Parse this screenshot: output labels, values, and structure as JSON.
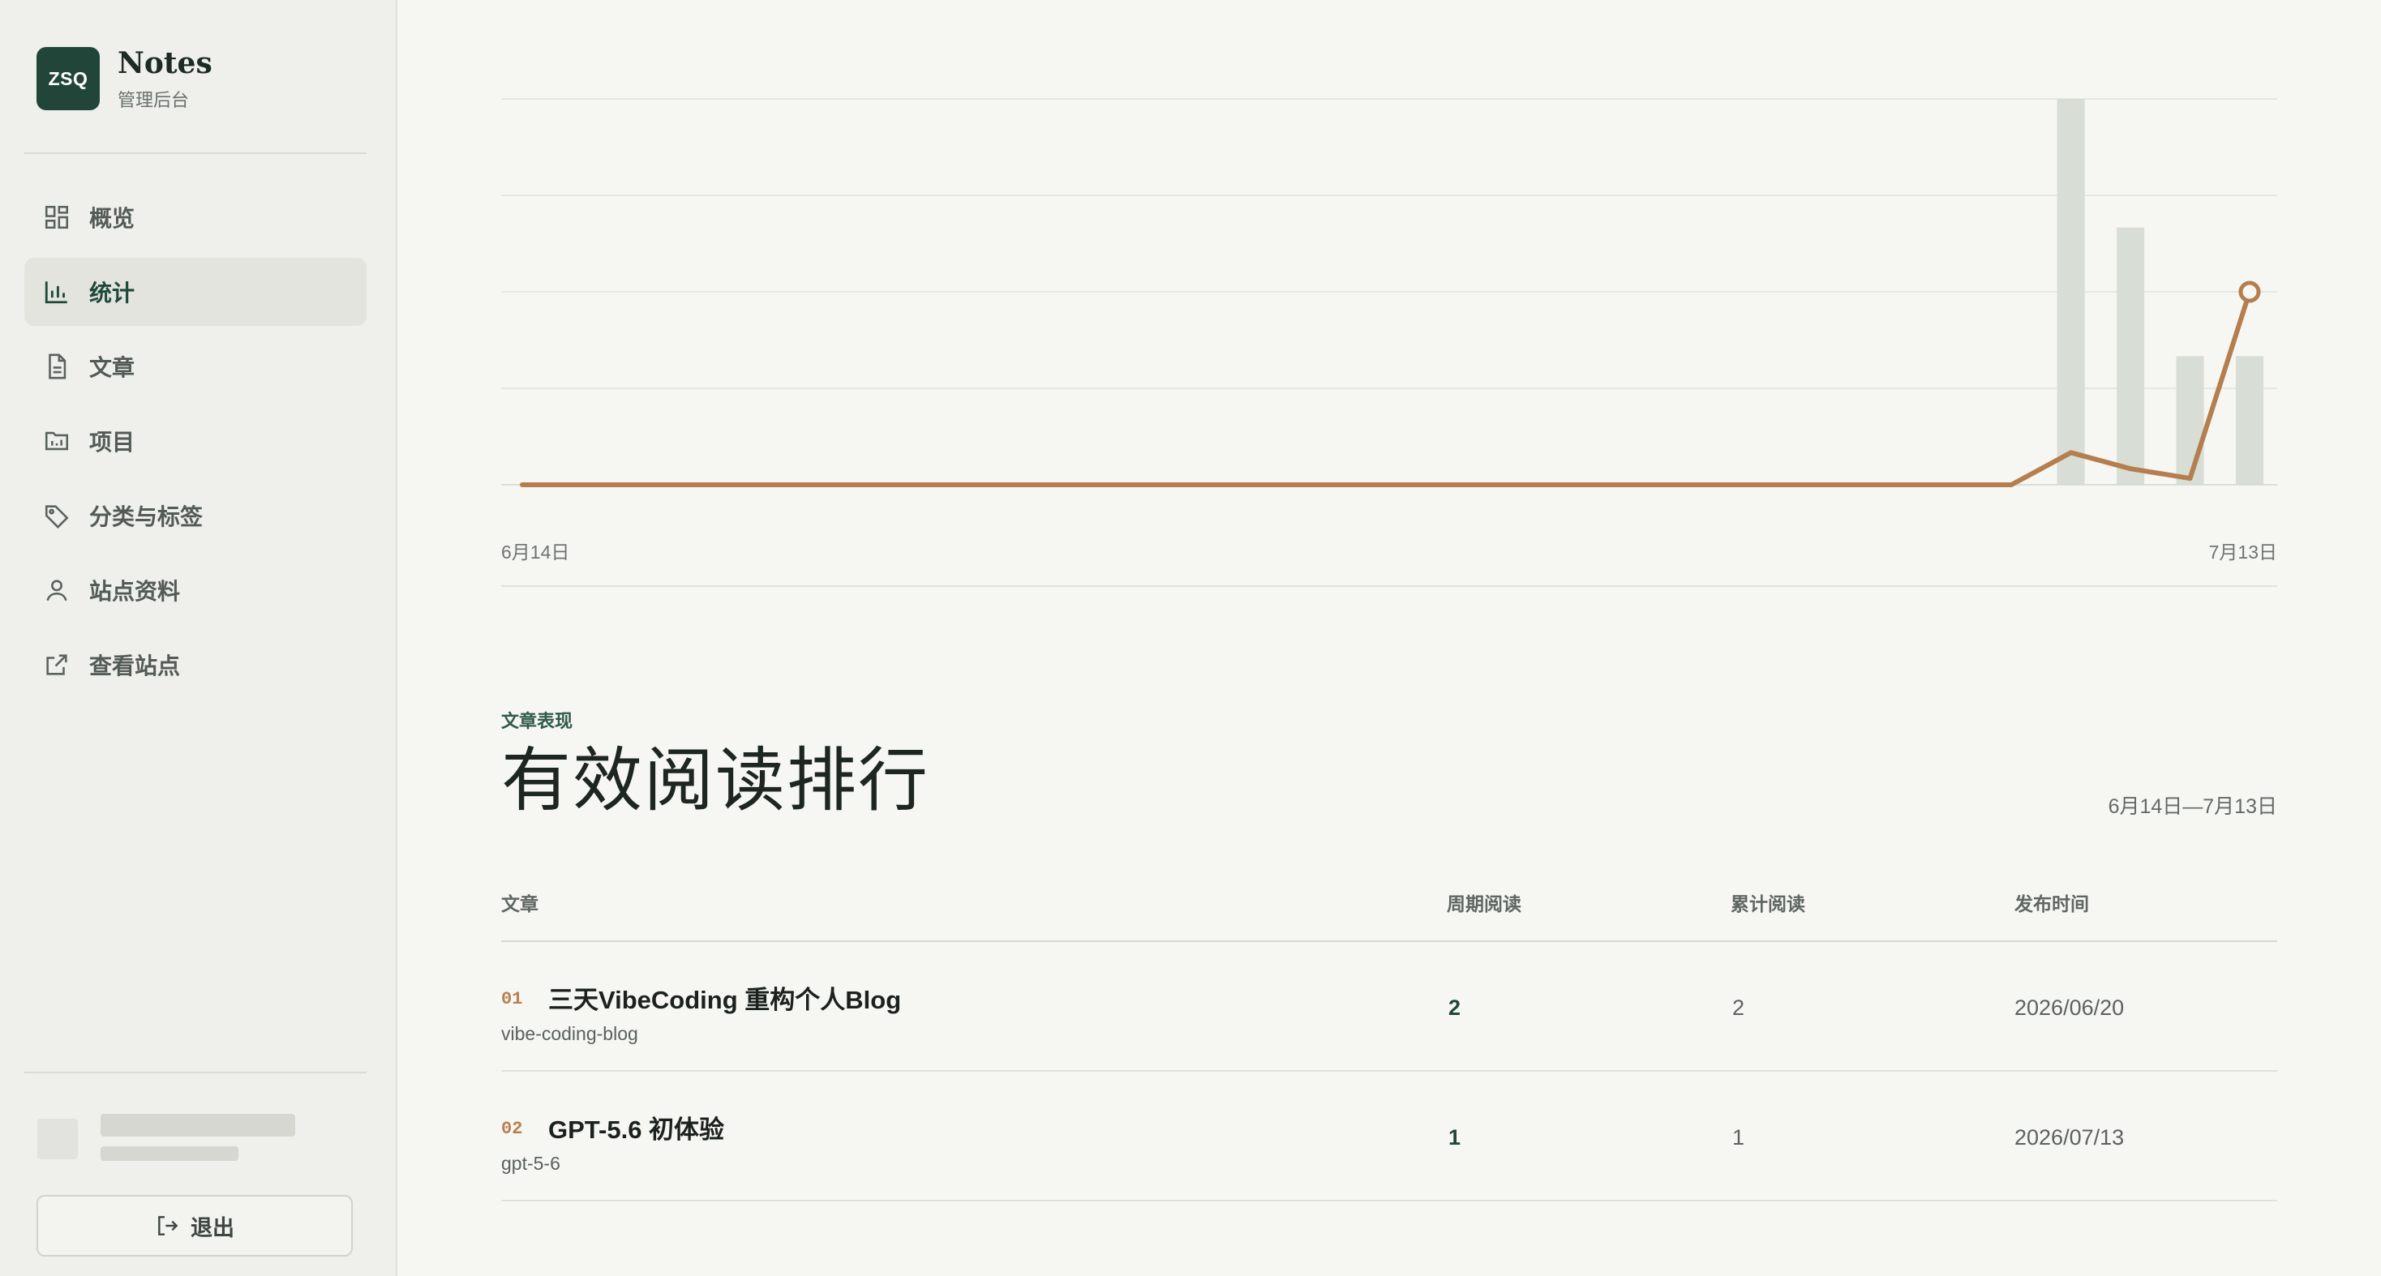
{
  "brand": {
    "logo_text": "ZSQ",
    "name": "Notes",
    "subtitle": "管理后台"
  },
  "sidebar": {
    "items": [
      {
        "label": "概览",
        "icon": "grid-icon",
        "active": false
      },
      {
        "label": "统计",
        "icon": "bar-chart-icon",
        "active": true
      },
      {
        "label": "文章",
        "icon": "document-icon",
        "active": false
      },
      {
        "label": "项目",
        "icon": "folder-icon",
        "active": false
      },
      {
        "label": "分类与标签",
        "icon": "tag-icon",
        "active": false
      },
      {
        "label": "站点资料",
        "icon": "user-icon",
        "active": false
      },
      {
        "label": "查看站点",
        "icon": "external-link-icon",
        "active": false
      }
    ],
    "logout_label": "退出"
  },
  "chart": {
    "x_start_label": "6月14日",
    "x_end_label": "7月13日"
  },
  "chart_data": {
    "type": "bar",
    "x_range": [
      "6月14日",
      "7月13日"
    ],
    "series": [
      {
        "type": "bar",
        "values": [
          0,
          0,
          0,
          0,
          0,
          0,
          0,
          0,
          0,
          0,
          0,
          0,
          0,
          0,
          0,
          0,
          0,
          0,
          0,
          0,
          0,
          0,
          0,
          0,
          0,
          0,
          6,
          4,
          2,
          2
        ]
      },
      {
        "type": "line",
        "values": [
          0,
          0,
          0,
          0,
          0,
          0,
          0,
          0,
          0,
          0,
          0,
          0,
          0,
          0,
          0,
          0,
          0,
          0,
          0,
          0,
          0,
          0,
          0,
          0,
          0,
          0,
          0.5,
          0.25,
          0.1,
          3
        ]
      }
    ],
    "ylim": [
      0,
      6
    ],
    "grid": true,
    "colors": {
      "bar": "#d8ddd6",
      "line": "#b57e4e"
    }
  },
  "section": {
    "eyebrow": "文章表现",
    "title": "有效阅读排行",
    "date_range": "6月14日—7月13日"
  },
  "table": {
    "headers": [
      "文章",
      "周期阅读",
      "累计阅读",
      "发布时间"
    ],
    "rows": [
      {
        "rank": "01",
        "title": "三天VibeCoding 重构个人Blog",
        "slug": "vibe-coding-blog",
        "period_reads": "2",
        "total_reads": "2",
        "published": "2026/06/20"
      },
      {
        "rank": "02",
        "title": "GPT-5.6 初体验",
        "slug": "gpt-5-6",
        "period_reads": "1",
        "total_reads": "1",
        "published": "2026/07/13"
      }
    ]
  },
  "colors": {
    "accent": "#22453a",
    "highlight": "#b57e4e",
    "background": "#f6f6f3",
    "sidebar": "#efefeb"
  }
}
